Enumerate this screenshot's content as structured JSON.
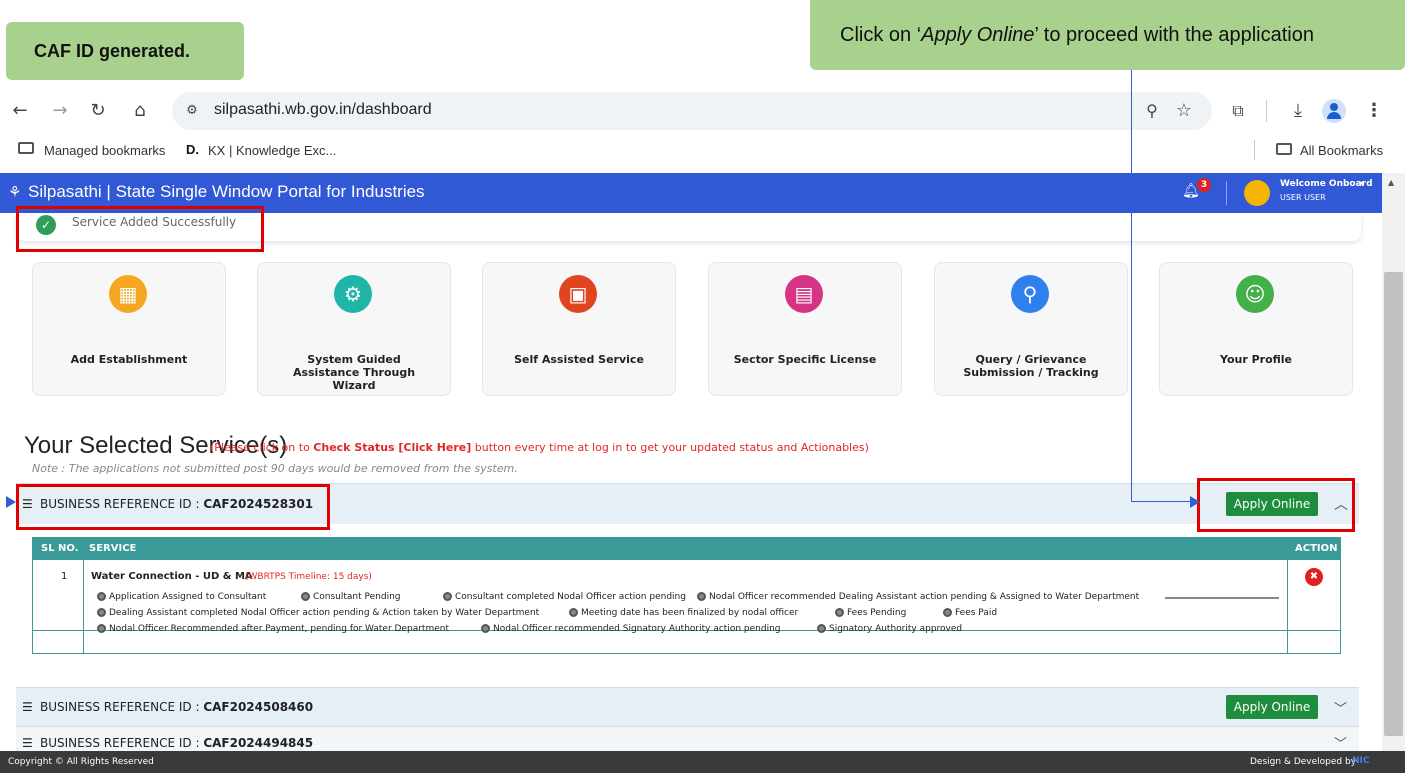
{
  "callouts": {
    "left": "CAF ID generated.",
    "right_prefix": "Click on ‘",
    "right_em": "Apply Online",
    "right_suffix": "’ to proceed with the application"
  },
  "browser": {
    "url": "silpasathi.wb.gov.in/dashboard",
    "bookmarks": [
      {
        "label": "Managed bookmarks",
        "icon": "folder-managed-icon"
      },
      {
        "label": "KX | Knowledge Exc...",
        "icon": "kx-logo-icon"
      }
    ],
    "all_bookmarks": "All Bookmarks"
  },
  "header": {
    "title": "Silpasathi | State Single Window Portal for Industries",
    "notification_count": "3",
    "welcome": "Welcome Onboard",
    "user": "USER USER"
  },
  "toast": {
    "message": "Service Added Successfully"
  },
  "cards": [
    {
      "label": "Add Establishment",
      "icon": "building-icon",
      "color": "#f5a623"
    },
    {
      "label": "System Guided Assistance Through Wizard",
      "icon": "gear-icon",
      "color": "#1fb5a8"
    },
    {
      "label": "Self Assisted Service",
      "icon": "grid-icon",
      "color": "#e0451f"
    },
    {
      "label": "Sector Specific License",
      "icon": "license-icon",
      "color": "#d63384"
    },
    {
      "label": "Query / Grievance Submission / Tracking",
      "icon": "search-icon",
      "color": "#2f80ed"
    },
    {
      "label": "Your Profile",
      "icon": "profile-icon",
      "color": "#43b04a"
    }
  ],
  "section": {
    "title": "Your Selected Service(s)",
    "note_prefix": "(Please click on to ",
    "note_bold": "Check Status [Click Here]",
    "note_suffix": " button every time at log in to get your updated status and Actionables)",
    "note_line": "Note : The applications not submitted post 90 days would be removed from the system."
  },
  "business": [
    {
      "label": "BUSINESS REFERENCE ID : ",
      "id": "CAF2024528301",
      "apply": "Apply Online"
    },
    {
      "label": "BUSINESS REFERENCE ID : ",
      "id": "CAF2024508460",
      "apply": "Apply Online"
    },
    {
      "label": "BUSINESS REFERENCE ID : ",
      "id": "CAF2024494845"
    }
  ],
  "table": {
    "headers": [
      "SL NO.",
      "SERVICE",
      "ACTION"
    ],
    "row": {
      "sl": "1",
      "service": "Water Connection - UD & MA",
      "timeline": "(WBRTPS Timeline: 15 days)",
      "statuses": [
        "Application Assigned to Consultant",
        "Consultant Pending",
        "Consultant completed Nodal Officer action pending",
        "Nodal Officer recommended Dealing Assistant action pending & Assigned to Water Department",
        "Dealing Assistant completed Nodal Officer action pending & Action taken by Water Department",
        "Meeting date has been finalized by nodal officer",
        "Fees Pending",
        "Fees Paid",
        "Nodal Officer Recommended after Payment, pending for Water Department",
        "Nodal Officer recommended Signatory Authority action pending",
        "Signatory Authority approved"
      ]
    }
  },
  "footer": {
    "left": "Copyright © All Rights Reserved",
    "right": "Design & Developed by",
    "brand": "NIC"
  }
}
